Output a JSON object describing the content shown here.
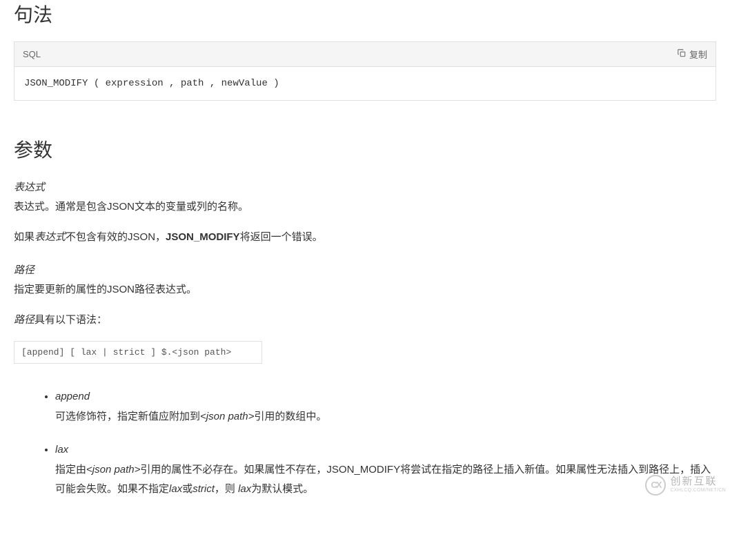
{
  "sections": {
    "syntax": {
      "heading": "句法",
      "code_lang": "SQL",
      "copy_label": "复制",
      "code": "JSON_MODIFY ( expression , path , newValue )"
    },
    "params": {
      "heading": "参数",
      "expression": {
        "name": "表达式",
        "desc1": "表达式。通常是包含JSON文本的变量或列的名称。",
        "desc2_prefix": "如果",
        "desc2_em": "表达式",
        "desc2_mid": "不包含有效的JSON，",
        "desc2_bold": "JSON_MODIFY",
        "desc2_suffix": "将返回一个错误。"
      },
      "path": {
        "name": "路径",
        "desc": "指定要更新的属性的JSON路径表达式。",
        "syntax_intro_em": "路径",
        "syntax_intro_rest": "具有以下语法：",
        "syntax_code": "[append] [ lax | strict ] $.<json path>"
      },
      "options": {
        "append": {
          "name": "append",
          "desc_prefix": "可选修饰符，指定新值应附加到",
          "desc_em": "<json path>",
          "desc_suffix": "引用的数组中。"
        },
        "lax": {
          "name": "lax",
          "desc_prefix": "指定由",
          "desc_em1": "<json path>",
          "desc_mid1": "引用的属性不必存在。如果属性不存在，JSON_MODIFY将尝试在指定的路径上插入新值。如果属性无法插入到路径上，插入可能会失败。如果不指定",
          "desc_em2": "lax",
          "desc_mid2": "或",
          "desc_em3": "strict",
          "desc_mid3": "，则 ",
          "desc_em4": "lax",
          "desc_suffix": "为默认模式。"
        }
      }
    }
  },
  "watermark": {
    "logo": "CX",
    "big": "创新互联",
    "small": "CXHLCQ.COM/NET/CN"
  }
}
